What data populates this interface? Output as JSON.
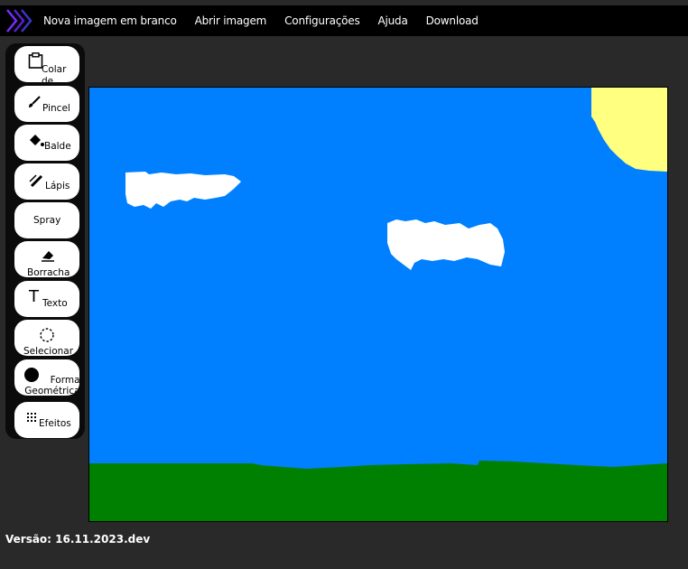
{
  "menu": {
    "items": [
      "Nova imagem em branco",
      "Abrir imagem",
      "Configurações",
      "Ajuda",
      "Download"
    ]
  },
  "tools": {
    "colar": "Colar de",
    "pincel": "Pincel",
    "balde": "Balde",
    "lapis": "Lápis",
    "spray": "Spray",
    "borracha": "Borracha",
    "texto": "Texto",
    "texto_icon": "T",
    "selecionar": "Selecionar",
    "formas": "Formas Geométricas",
    "efeitos": "Efeitos"
  },
  "footer": {
    "version": "Versão: 16.11.2023.dev"
  },
  "colors": {
    "sky": "#0080ff",
    "grass": "#008000",
    "sun": "#ffff80",
    "cloud": "#ffffff",
    "accent": "#7a2cff"
  }
}
